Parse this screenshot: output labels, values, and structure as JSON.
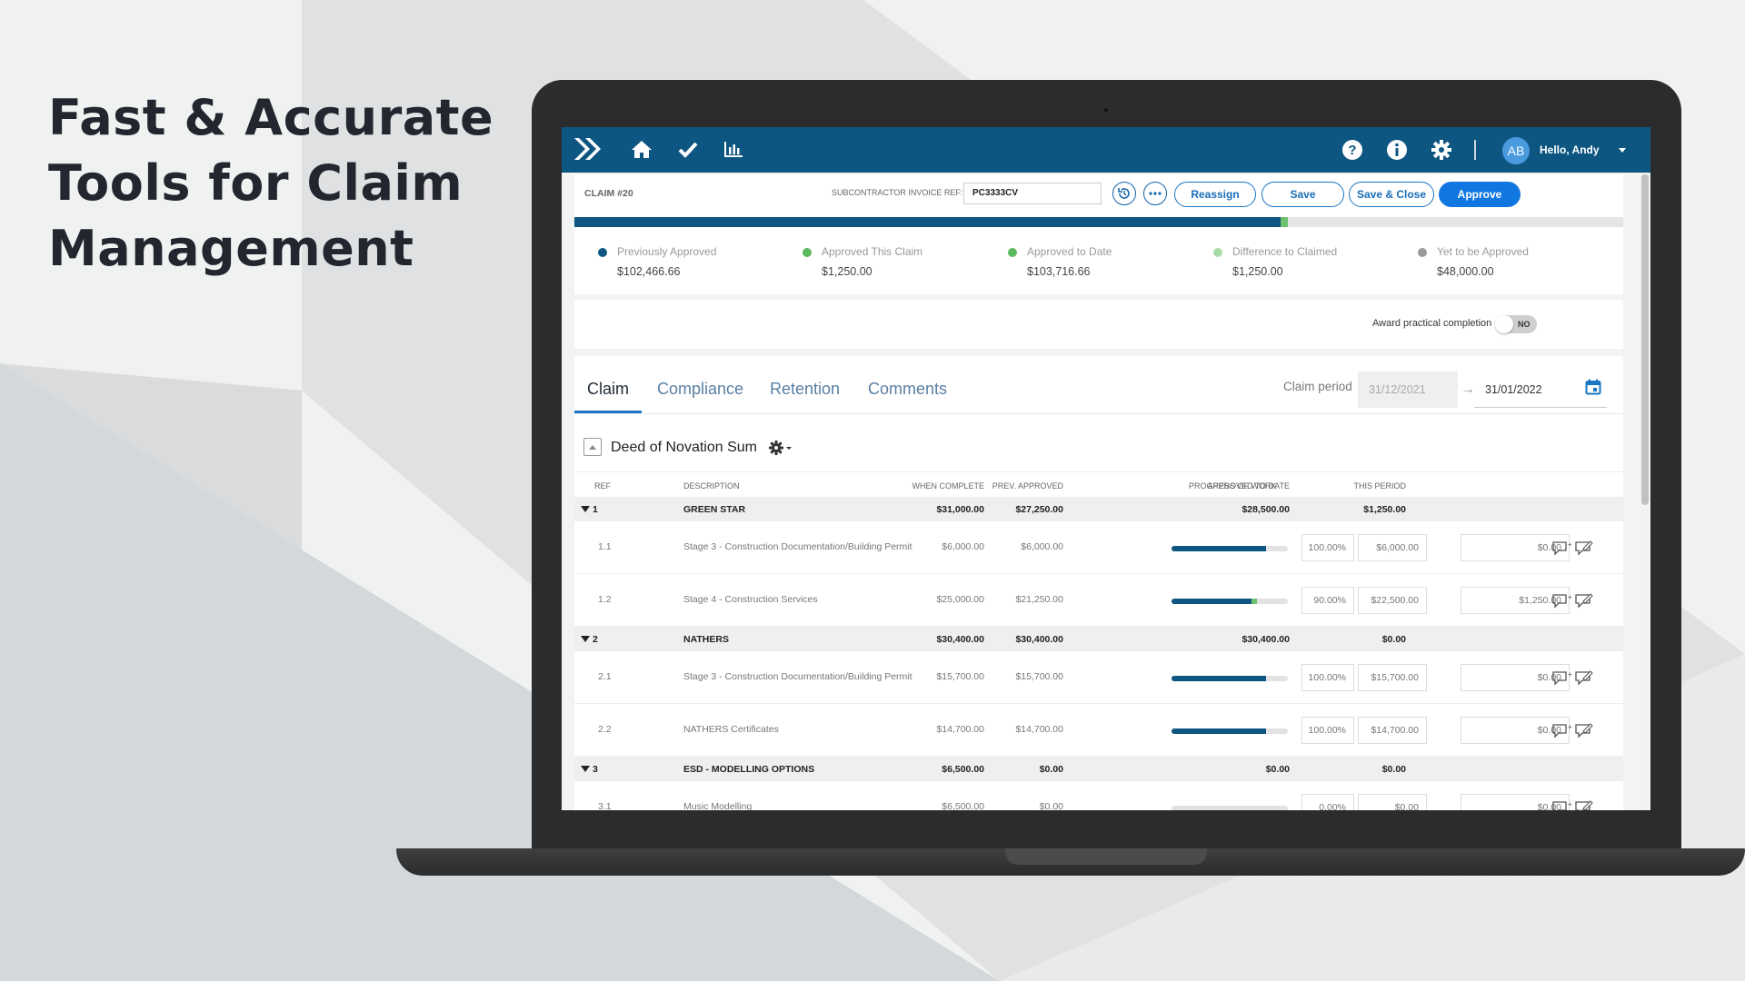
{
  "headline": [
    "Fast & Accurate",
    "Tools for Claim",
    "Management"
  ],
  "nav": {
    "icons": [
      "logo-chevrons-icon",
      "home-icon",
      "check-icon",
      "chart-icon",
      "help-icon",
      "info-icon",
      "gear-icon",
      "caret-down-icon"
    ],
    "avatar_initials": "AB",
    "greeting": "Hello, Andy"
  },
  "claim": {
    "title": "CLAIM #20",
    "sub_ref_label": "SUBCONTRACTOR INVOICE REF:",
    "sub_ref_value": "PC3333CV",
    "buttons": {
      "reassign": "Reassign",
      "save": "Save",
      "save_close": "Save & Close",
      "approve": "Approve"
    },
    "progress": {
      "approved_fraction": 0.673,
      "this_claim_fraction": 0.007
    }
  },
  "summary": [
    {
      "label": "Previously Approved",
      "value": "$102,466.66",
      "color": "#0e5682"
    },
    {
      "label": "Approved This Claim",
      "value": "$1,250.00",
      "color": "#5cb85c"
    },
    {
      "label": "Approved to Date",
      "value": "$103,716.66",
      "color": "#5cb85c"
    },
    {
      "label": "Difference to Claimed",
      "value": "$1,250.00",
      "color": "#a8dca8"
    },
    {
      "label": "Yet to be Approved",
      "value": "$48,000.00",
      "color": "#9a9a9a"
    }
  ],
  "award": {
    "label": "Award practical completion",
    "toggle": "NO"
  },
  "tabs": [
    "Claim",
    "Compliance",
    "Retention",
    "Comments"
  ],
  "claim_period": {
    "label": "Claim period",
    "from": "31/12/2021",
    "to": "31/01/2022"
  },
  "section": {
    "title": "Deed of Novation Sum"
  },
  "columns": [
    "REF",
    "DESCRIPTION",
    "WHEN COMPLETE",
    "PREV. APPROVED",
    "PROGRESS OF WORK",
    "APPROVED TO DATE",
    "THIS PERIOD"
  ],
  "groups": [
    {
      "ref": "1",
      "desc": "GREEN STAR",
      "when": "$31,000.00",
      "prev": "$27,250.00",
      "atd": "$28,500.00",
      "period": "$1,250.00",
      "items": [
        {
          "ref": "1.1",
          "desc": "Stage 3 - Construction Documentation/Building Permit",
          "when": "$6,000.00",
          "prev": "$6,000.00",
          "pct": "100.00%",
          "atd": "$6,000.00",
          "period": "$0.00",
          "progress": 1.0,
          "prev_fraction": 1.0
        },
        {
          "ref": "1.2",
          "desc": "Stage 4 - Construction Services",
          "when": "$25,000.00",
          "prev": "$21,250.00",
          "pct": "90.00%",
          "atd": "$22,500.00",
          "period": "$1,250.00",
          "progress": 0.9,
          "prev_fraction": 0.85
        }
      ]
    },
    {
      "ref": "2",
      "desc": "NATHERS",
      "when": "$30,400.00",
      "prev": "$30,400.00",
      "atd": "$30,400.00",
      "period": "$0.00",
      "items": [
        {
          "ref": "2.1",
          "desc": "Stage 3 - Construction Documentation/Building Permit",
          "when": "$15,700.00",
          "prev": "$15,700.00",
          "pct": "100.00%",
          "atd": "$15,700.00",
          "period": "$0.00",
          "progress": 1.0,
          "prev_fraction": 1.0
        },
        {
          "ref": "2.2",
          "desc": "NATHERS Certificates",
          "when": "$14,700.00",
          "prev": "$14,700.00",
          "pct": "100.00%",
          "atd": "$14,700.00",
          "period": "$0.00",
          "progress": 1.0,
          "prev_fraction": 1.0
        }
      ]
    },
    {
      "ref": "3",
      "desc": "ESD - MODELLING OPTIONS",
      "when": "$6,500.00",
      "prev": "$0.00",
      "atd": "$0.00",
      "period": "$0.00",
      "items": [
        {
          "ref": "3.1",
          "desc": "Music Modelling",
          "when": "$6,500.00",
          "prev": "$0.00",
          "pct": "0.00%",
          "atd": "$0.00",
          "period": "$0.00",
          "progress": 0.0,
          "prev_fraction": 0.0
        }
      ]
    }
  ]
}
